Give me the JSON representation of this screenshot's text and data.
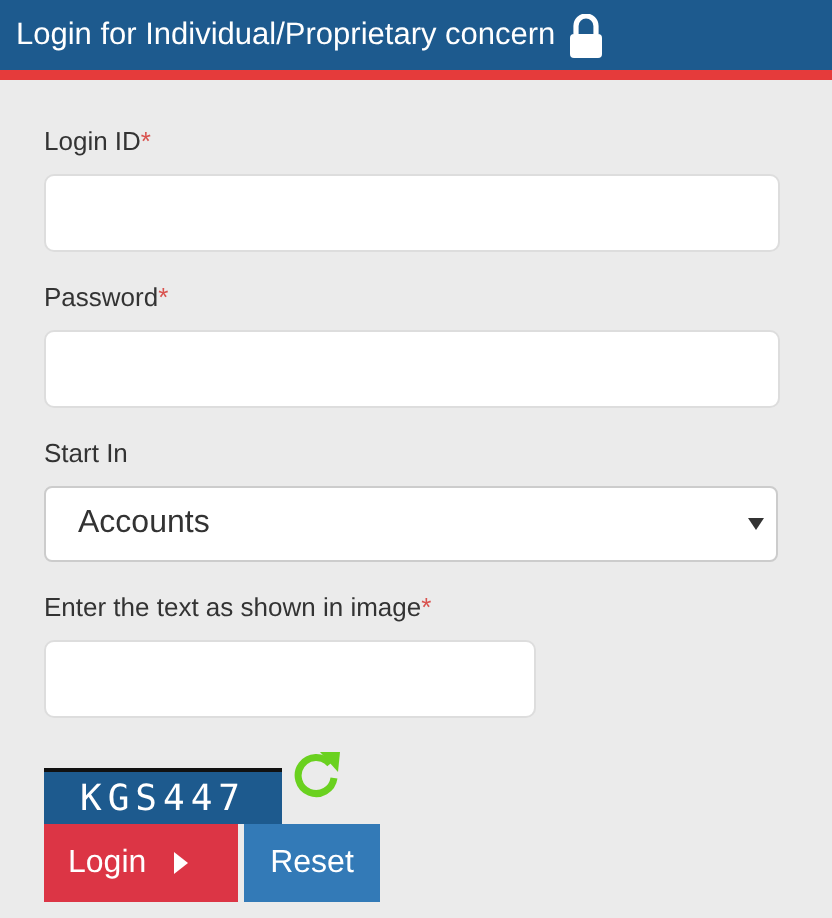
{
  "header": {
    "title": "Login for Individual/Proprietary concern"
  },
  "fields": [
    {
      "kind": "text",
      "label": "Login ID",
      "required_mark": "*"
    },
    {
      "kind": "password",
      "label": "Password",
      "required_mark": "*"
    },
    {
      "kind": "select",
      "label": "Start In",
      "value": "Accounts"
    },
    {
      "kind": "captcha",
      "label": "Enter the text as shown in image",
      "required_mark": "*"
    }
  ],
  "captcha": {
    "text": "KGS447"
  },
  "buttons": [
    {
      "kind": "primary",
      "label": "Login"
    },
    {
      "kind": "secondary",
      "label": "Reset"
    }
  ]
}
